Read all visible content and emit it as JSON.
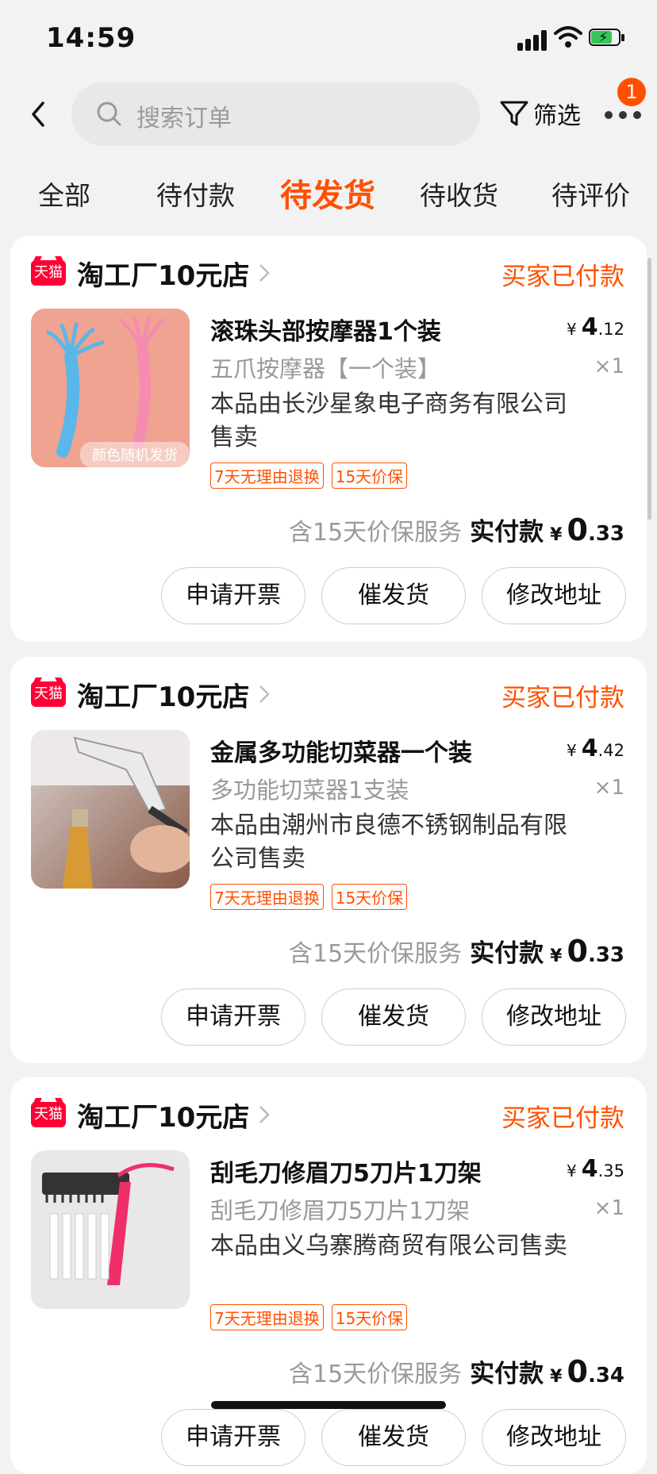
{
  "status_bar": {
    "time": "14:59",
    "battery_color": "#32c759"
  },
  "header": {
    "search_placeholder": "搜索订单",
    "filter_label": "筛选",
    "badge_count": "1",
    "accent_color": "#ff5000"
  },
  "tabs": [
    {
      "label": "全部",
      "active": false
    },
    {
      "label": "待付款",
      "active": false
    },
    {
      "label": "待发货",
      "active": true
    },
    {
      "label": "待收货",
      "active": false
    },
    {
      "label": "待评价",
      "active": false
    }
  ],
  "orders": [
    {
      "shop_badge": "天猫",
      "shop_name": "淘工厂10元店",
      "status": "买家已付款",
      "product_title": "滚珠头部按摩器1个装",
      "product_spec": "五爪按摩器【一个装】",
      "seller_note": "本品由长沙星象电子商务有限公司售卖",
      "tags": [
        "7天无理由退换",
        "15天价保"
      ],
      "image_caption": "颜色随机发货",
      "price_symbol": "¥",
      "price_int": "4",
      "price_dec": ".12",
      "quantity": "×1",
      "pay_note": "含15天价保服务",
      "pay_label": "实付款",
      "pay_symbol": "¥",
      "pay_int": "0",
      "pay_dec": ".33",
      "actions": [
        "申请开票",
        "催发货",
        "修改地址"
      ]
    },
    {
      "shop_badge": "天猫",
      "shop_name": "淘工厂10元店",
      "status": "买家已付款",
      "product_title": "金属多功能切菜器一个装",
      "product_spec": "多功能切菜器1支装",
      "seller_note": "本品由潮州市良德不锈钢制品有限公司售卖",
      "tags": [
        "7天无理由退换",
        "15天价保"
      ],
      "price_symbol": "¥",
      "price_int": "4",
      "price_dec": ".42",
      "quantity": "×1",
      "pay_note": "含15天价保服务",
      "pay_label": "实付款",
      "pay_symbol": "¥",
      "pay_int": "0",
      "pay_dec": ".33",
      "actions": [
        "申请开票",
        "催发货",
        "修改地址"
      ]
    },
    {
      "shop_badge": "天猫",
      "shop_name": "淘工厂10元店",
      "status": "买家已付款",
      "product_title": "刮毛刀修眉刀5刀片1刀架",
      "product_spec": "刮毛刀修眉刀5刀片1刀架",
      "seller_note": "本品由义乌寨腾商贸有限公司售卖",
      "tags": [
        "7天无理由退换",
        "15天价保"
      ],
      "price_symbol": "¥",
      "price_int": "4",
      "price_dec": ".35",
      "quantity": "×1",
      "pay_note": "含15天价保服务",
      "pay_label": "实付款",
      "pay_symbol": "¥",
      "pay_int": "0",
      "pay_dec": ".34",
      "actions": [
        "申请开票",
        "催发货",
        "修改地址"
      ]
    }
  ]
}
